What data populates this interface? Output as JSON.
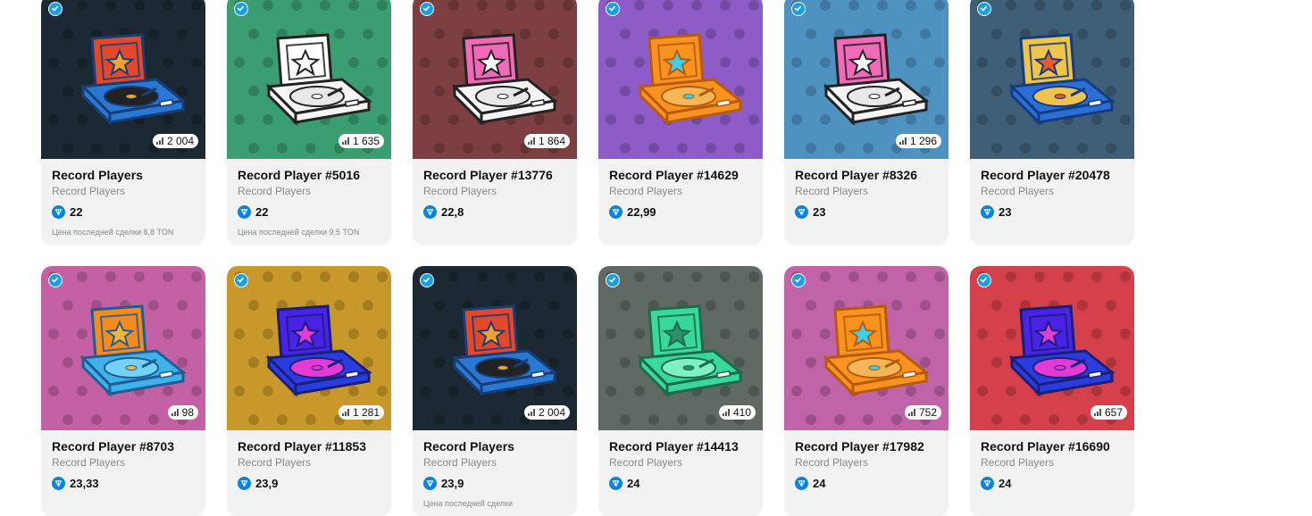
{
  "colors": {
    "card_bg": "#f2f2f2",
    "ton_blue": "#0a84d6",
    "verified_blue": "#1a9fe0"
  },
  "cards": [
    {
      "title": "Record Players",
      "subtitle": "Record Players",
      "price": "22",
      "count": "2 004",
      "last_sale": "Цена последней сделки 8,8 TON",
      "bg": "#1c2833",
      "style": "multi"
    },
    {
      "title": "Record Player #5016",
      "subtitle": "Record Players",
      "price": "22",
      "count": "1 635",
      "last_sale": "Цена последней сделки 9,5 TON",
      "bg": "#3a9e70",
      "style": "white"
    },
    {
      "title": "Record Player #13776",
      "subtitle": "Record Players",
      "price": "22,8",
      "count": "1 864",
      "last_sale": "",
      "bg": "#7d3f42",
      "style": "pink"
    },
    {
      "title": "Record Player #14629",
      "subtitle": "Record Players",
      "price": "22,99",
      "count": "",
      "last_sale": "",
      "bg": "#8e5cc9",
      "style": "orange-cyan"
    },
    {
      "title": "Record Player #8326",
      "subtitle": "Record Players",
      "price": "23",
      "count": "1 296",
      "last_sale": "",
      "bg": "#4e92c2",
      "style": "pink"
    },
    {
      "title": "Record Player #20478",
      "subtitle": "Record Players",
      "price": "23",
      "count": "",
      "last_sale": "",
      "bg": "#3f5f78",
      "style": "blue-gold"
    },
    {
      "title": "Record Player #8703",
      "subtitle": "Record Players",
      "price": "23,33",
      "count": "98",
      "last_sale": "",
      "bg": "#c461a5",
      "style": "cyan-orange"
    },
    {
      "title": "Record Player #11853",
      "subtitle": "Record Players",
      "price": "23,9",
      "count": "1 281",
      "last_sale": "",
      "bg": "#c9982a",
      "style": "violet"
    },
    {
      "title": "Record Players",
      "subtitle": "Record Players",
      "price": "23,9",
      "count": "2 004",
      "last_sale": "Цена последней сделки",
      "bg": "#1c2833",
      "style": "multi"
    },
    {
      "title": "Record Player #14413",
      "subtitle": "Record Players",
      "price": "24",
      "count": "410",
      "last_sale": "",
      "bg": "#5e6a62",
      "style": "green"
    },
    {
      "title": "Record Player #17982",
      "subtitle": "Record Players",
      "price": "24",
      "count": "752",
      "last_sale": "",
      "bg": "#c063a8",
      "style": "orange-cyan"
    },
    {
      "title": "Record Player #16690",
      "subtitle": "Record Players",
      "price": "24",
      "count": "657",
      "last_sale": "",
      "bg": "#d6404a",
      "style": "violet"
    }
  ]
}
